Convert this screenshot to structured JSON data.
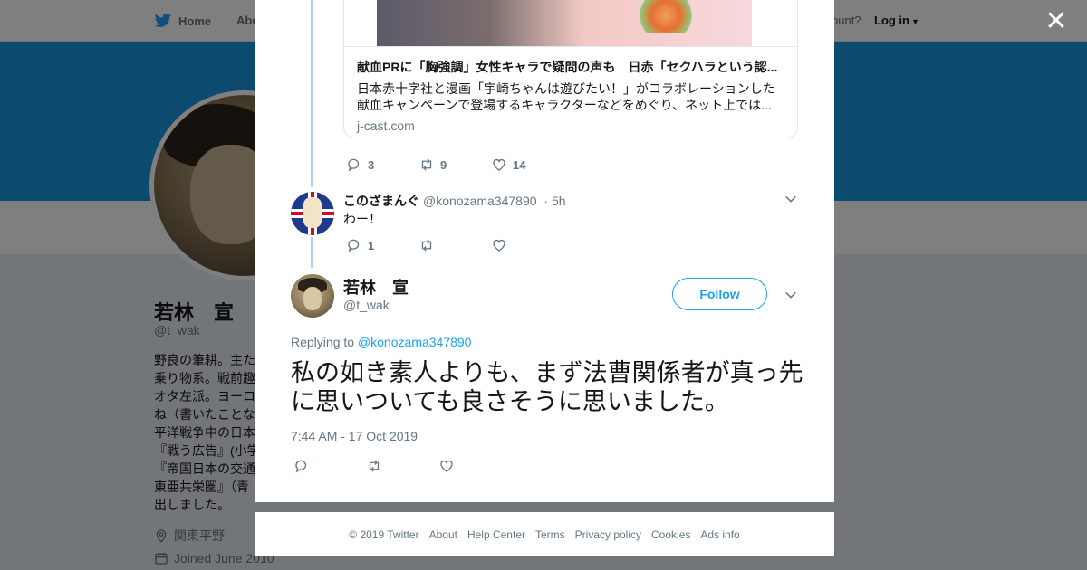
{
  "nav": {
    "home": "Home",
    "about": "Abo",
    "account_prompt": "ccount?",
    "login": "Log in"
  },
  "profile": {
    "name": "若林　宣",
    "handle": "@t_wak",
    "bio": "野良の筆耕。主た\n乗り物系。戦前趣\nオタ左派。ヨーロ\nね（書いたことな\n平洋戦争中の日本\n『戦う広告』(小学\n『帝国日本の交通\n東亜共栄圏』（青\n出しました。",
    "location": "関東平野",
    "joined": "Joined June 2010"
  },
  "close_icon": "close-icon",
  "card": {
    "title": "献血PRに「胸強調」女性キャラで疑問の声も　日赤「セクハラという認...",
    "description": "日本赤十字社と漫画「宇崎ちゃんは遊びたい！」がコラボレーションした献血キャンペーンで登場するキャラクターなどをめぐり、ネット上では...",
    "domain": "j-cast.com"
  },
  "parent_actions": {
    "replies": "3",
    "retweets": "9",
    "likes": "14"
  },
  "reply": {
    "name": "このざまんぐ",
    "handle": "@konozama347890",
    "time": "· 5h",
    "text": "わー！",
    "replies": "1"
  },
  "main_tweet": {
    "name": "若林　宣",
    "handle": "@t_wak",
    "follow_label": "Follow",
    "replying_prefix": "Replying to",
    "replying_handle": "@konozama347890",
    "text": "私の如き素人よりも、まず法曹関係者が真っ先に思いついても良さそうに思いました。",
    "timestamp": "7:44 AM - 17 Oct 2019"
  },
  "footer": {
    "links": [
      "© 2019 Twitter",
      "About",
      "Help Center",
      "Terms",
      "Privacy policy",
      "Cookies",
      "Ads info"
    ]
  },
  "colors": {
    "twitter_blue": "#1da1f2",
    "banner": "#1b95e0",
    "thread_line": "#a6d4f2"
  }
}
